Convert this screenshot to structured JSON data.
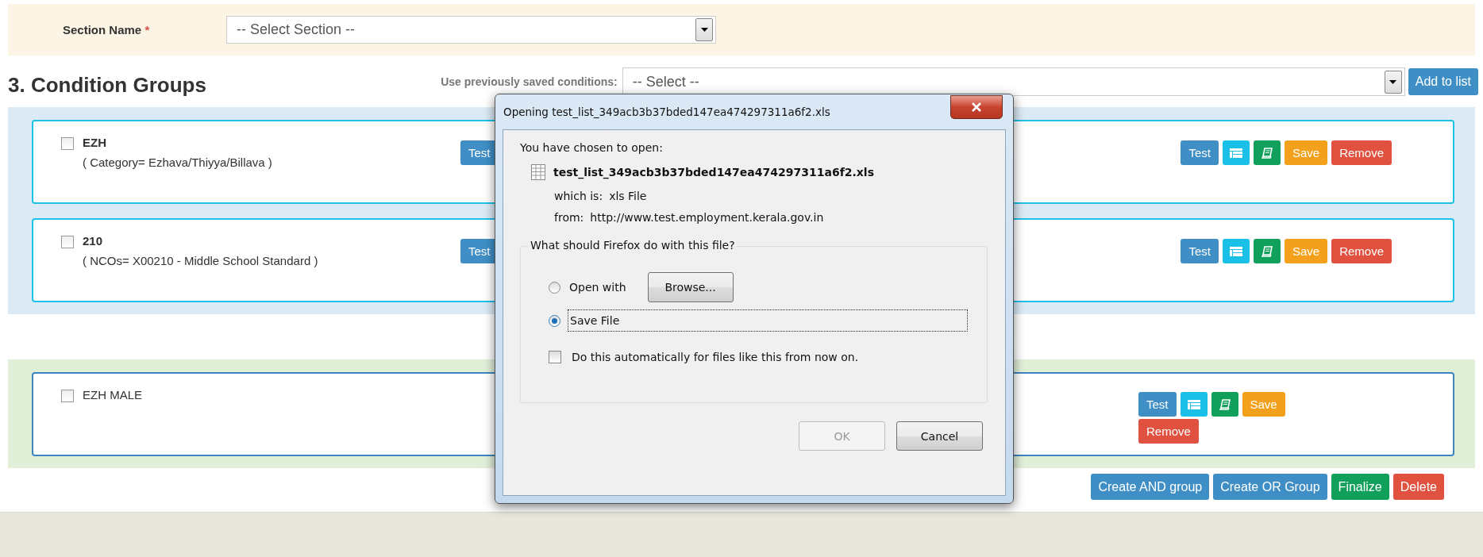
{
  "section_field": {
    "label": "Section Name",
    "required_mark": "*",
    "placeholder": "-- Select Section --"
  },
  "heading": "3. Condition Groups",
  "saved_conditions": {
    "label": "Use previously saved conditions:",
    "placeholder": "-- Select --",
    "button": "Add to list"
  },
  "bands": [
    {
      "kind": "info",
      "cards": [
        {
          "name": "EZH",
          "condition": "( Category= Ezhava/Thiyya/Billava )",
          "checked": false,
          "compact": false,
          "inner_button": "Test",
          "actions": [
            {
              "kind": "test",
              "label": "Test"
            },
            {
              "kind": "table"
            },
            {
              "kind": "book"
            },
            {
              "kind": "save",
              "label": "Save"
            },
            {
              "kind": "remove",
              "label": "Remove"
            }
          ]
        },
        {
          "name": "210",
          "condition": "( NCOs= X00210 - Middle School Standard )",
          "checked": false,
          "compact": false,
          "inner_button": "Test",
          "actions": [
            {
              "kind": "test",
              "label": "Test"
            },
            {
              "kind": "table"
            },
            {
              "kind": "book"
            },
            {
              "kind": "save",
              "label": "Save"
            },
            {
              "kind": "remove",
              "label": "Remove"
            }
          ]
        }
      ]
    },
    {
      "kind": "success",
      "cards": [
        {
          "name": "EZH MALE",
          "checked": false,
          "compact": true,
          "actions": [
            {
              "kind": "test",
              "label": "Test"
            },
            {
              "kind": "table"
            },
            {
              "kind": "book"
            },
            {
              "kind": "save",
              "label": "Save"
            },
            {
              "kind": "remove",
              "label": "Remove"
            }
          ]
        }
      ]
    }
  ],
  "footer_buttons": [
    {
      "kind": "test",
      "label": "Create AND group"
    },
    {
      "kind": "test",
      "label": "Create OR Group"
    },
    {
      "kind": "book",
      "label": "Finalize"
    },
    {
      "kind": "remove",
      "label": "Delete"
    }
  ],
  "dialog": {
    "title": "Opening test_list_349acb3b37bded147ea474297311a6f2.xls",
    "intro": "You have chosen to open:",
    "file_name": "test_list_349acb3b37bded147ea474297311a6f2.xls",
    "type_label": "which is:",
    "type_value": "xls File",
    "from_label": "from:",
    "from_value": "http://www.test.employment.kerala.gov.in",
    "legend": "What should Firefox do with this file?",
    "options": [
      {
        "label": "Open with",
        "selected": false,
        "button": {
          "label": "Browse..."
        }
      },
      {
        "label": "Save File",
        "selected": true
      }
    ],
    "remember": {
      "label": "Do this automatically for files like this from now on.",
      "checked": false
    },
    "buttons": [
      {
        "label": "OK",
        "disabled": true
      },
      {
        "label": "Cancel",
        "disabled": false
      }
    ]
  }
}
